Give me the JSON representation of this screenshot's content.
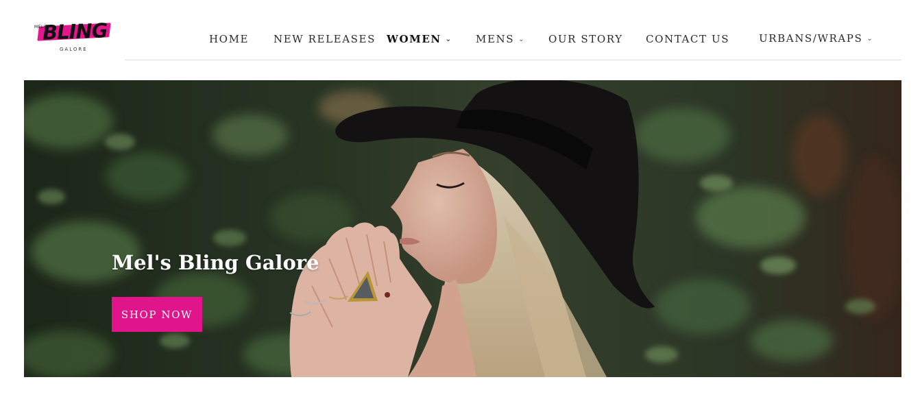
{
  "logo": {
    "prefix": "MELS",
    "name": "BLING",
    "suffix": "GALORE",
    "accent_color": "#e5178f"
  },
  "nav": {
    "items": [
      {
        "label": "HOME",
        "has_dropdown": false,
        "active": false
      },
      {
        "label": "NEW RELEASES",
        "has_dropdown": false,
        "active": false
      },
      {
        "label": "WOMEN",
        "has_dropdown": true,
        "active": true
      },
      {
        "label": "MENS",
        "has_dropdown": true,
        "active": false
      },
      {
        "label": "OUR STORY",
        "has_dropdown": false,
        "active": false
      },
      {
        "label": "CONTACT US",
        "has_dropdown": false,
        "active": false
      },
      {
        "label": "URBANS/WRAPS",
        "has_dropdown": true,
        "active": false
      }
    ],
    "dropdown_icon": "chevron-down-icon"
  },
  "hero": {
    "title": "Mel's Bling Galore",
    "button_label": "SHOP NOW",
    "button_color": "#e0158b"
  }
}
